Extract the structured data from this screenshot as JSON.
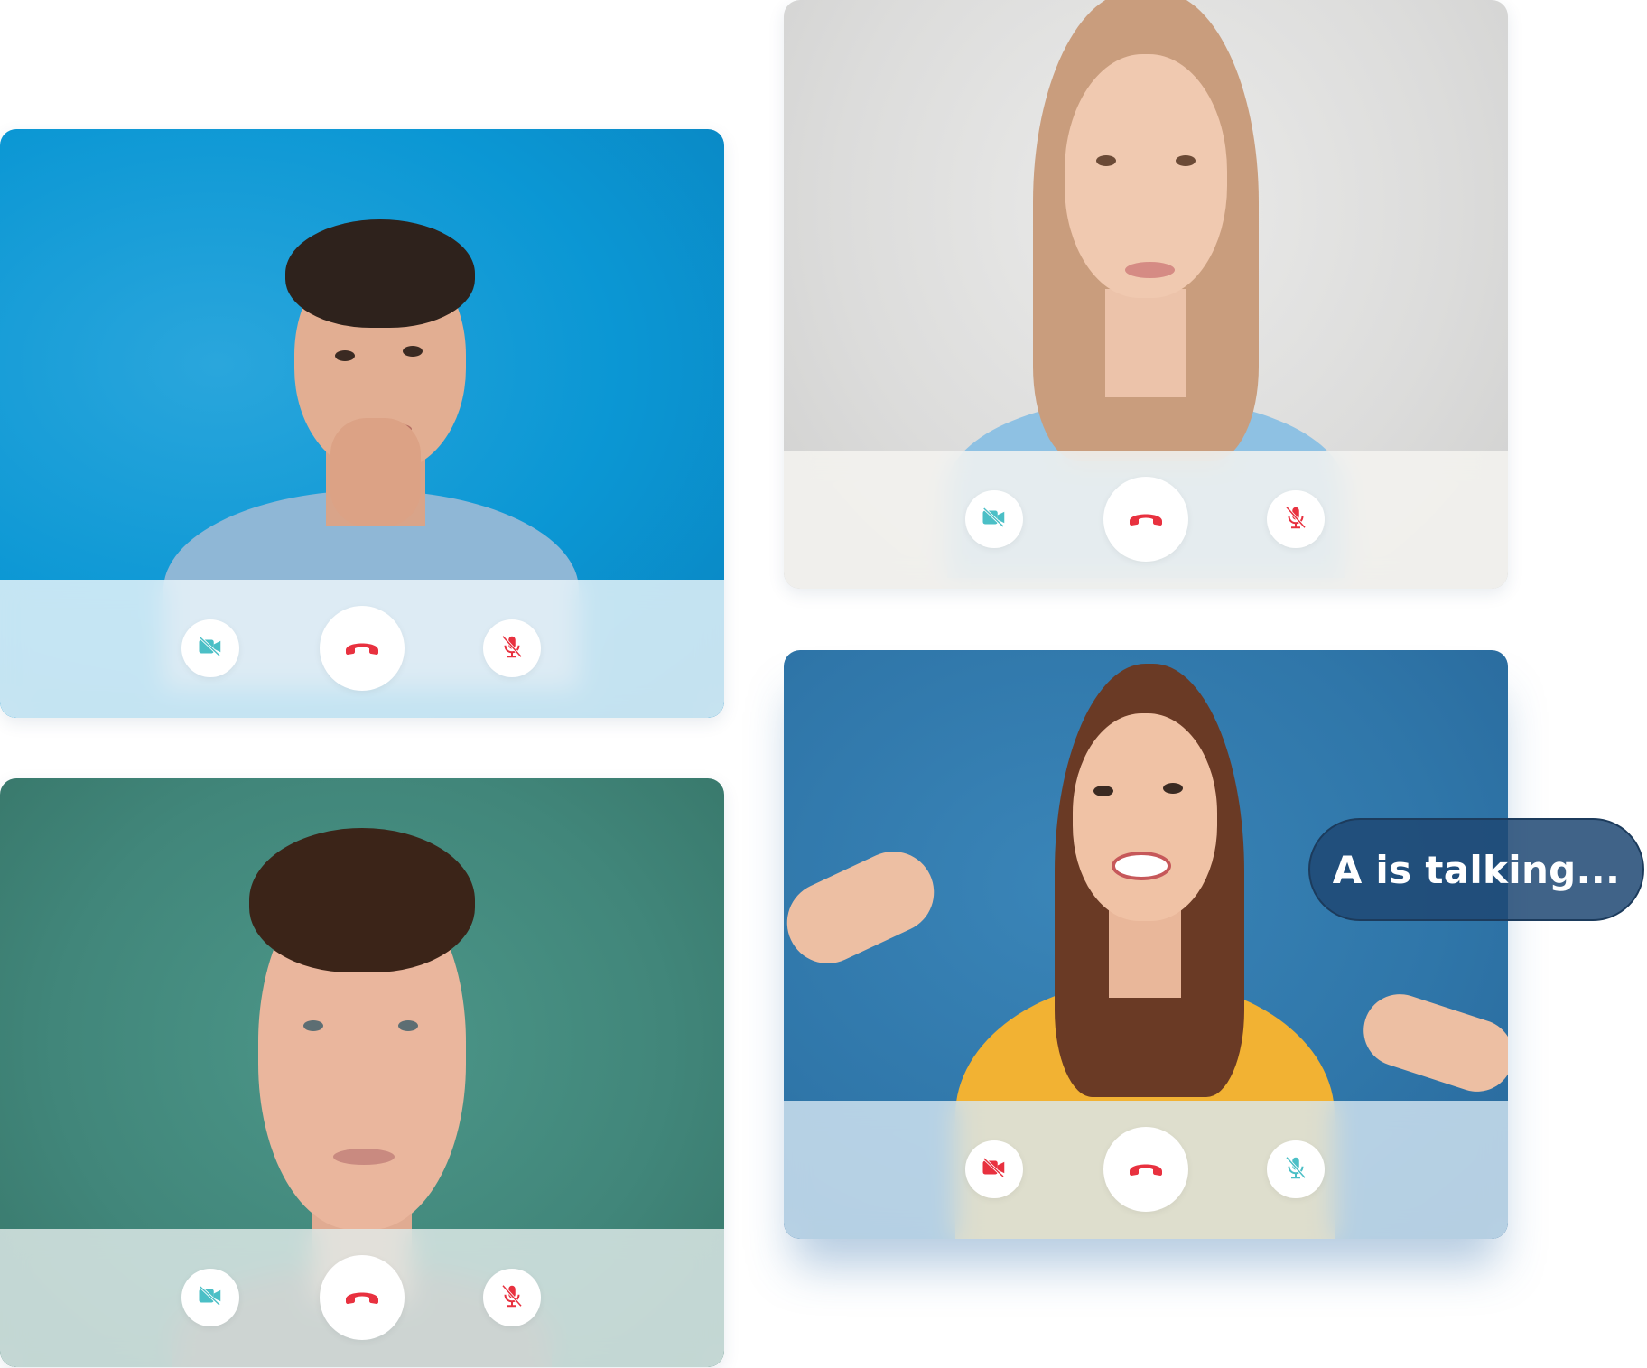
{
  "participants": [
    {
      "id": 1,
      "camera_state": "off",
      "mic_state": "muted",
      "camera_icon": "camera-off-icon",
      "end_icon": "phone-hangup-icon",
      "mic_icon": "mic-off-icon",
      "camera_color": "#4bbfc6",
      "mic_color": "#e8313f"
    },
    {
      "id": 2,
      "camera_state": "off",
      "mic_state": "muted",
      "camera_icon": "camera-off-icon",
      "end_icon": "phone-hangup-icon",
      "mic_icon": "mic-off-icon",
      "camera_color": "#4bbfc6",
      "mic_color": "#e8313f"
    },
    {
      "id": 3,
      "camera_state": "off",
      "mic_state": "muted",
      "camera_icon": "camera-off-icon",
      "end_icon": "phone-hangup-icon",
      "mic_icon": "mic-off-icon",
      "camera_color": "#4bbfc6",
      "mic_color": "#e8313f"
    },
    {
      "id": 4,
      "camera_state": "off",
      "mic_state": "muted",
      "camera_icon": "camera-off-icon",
      "end_icon": "phone-hangup-icon",
      "mic_icon": "mic-off-icon",
      "camera_color": "#e8313f",
      "mic_color": "#4bbfc6"
    }
  ],
  "talking_indicator": {
    "label": "A is talking..."
  },
  "colors": {
    "hangup": "#e8313f",
    "bubble_bg": "#1e4873",
    "bubble_border": "#1c3b5c"
  }
}
